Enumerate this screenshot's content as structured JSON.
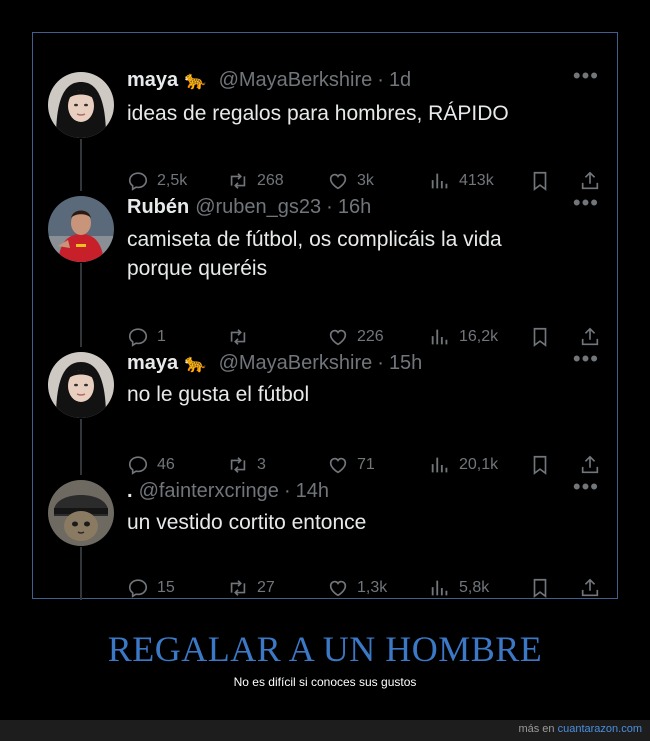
{
  "tweets": [
    {
      "name": "maya",
      "emoji": "🐆",
      "handle": "@MayaBerkshire",
      "time": "1d",
      "text": [
        "ideas de regalos para hombres, RÁPIDO"
      ],
      "replies": "2,5k",
      "retweets": "268",
      "likes": "3k",
      "views": "413k"
    },
    {
      "name": "Rubén",
      "emoji": "",
      "handle": "@ruben_gs23",
      "time": "16h",
      "text": [
        "camiseta de fútbol, os complicáis la vida",
        "porque queréis"
      ],
      "replies": "1",
      "retweets": "",
      "likes": "226",
      "views": "16,2k"
    },
    {
      "name": "maya",
      "emoji": "🐆",
      "handle": "@MayaBerkshire",
      "time": "15h",
      "text": [
        "no le gusta el fútbol"
      ],
      "replies": "46",
      "retweets": "3",
      "likes": "71",
      "views": "20,1k"
    },
    {
      "name": ".",
      "emoji": "",
      "handle": "@fainterxcringe",
      "time": "14h",
      "text": [
        "un vestido cortito entonce"
      ],
      "replies": "15",
      "retweets": "27",
      "likes": "1,3k",
      "views": "5,8k"
    }
  ],
  "more_glyph": "•••",
  "separator": "·",
  "caption": {
    "title": "REGALAR A UN HOMBRE",
    "subtitle": "No es difícil si conoces sus gustos"
  },
  "footer": {
    "prefix": "más en ",
    "link": "cuantarazon.com"
  },
  "colors": {
    "frame_border": "#3f5f8e",
    "muted": "#71767b",
    "text": "#e7e9ea",
    "caption_title": "#3b79c6",
    "footer_link": "#4a8fe0"
  },
  "icons": [
    "reply-icon",
    "retweet-icon",
    "like-icon",
    "views-icon",
    "bookmark-icon",
    "share-icon",
    "more-icon"
  ]
}
